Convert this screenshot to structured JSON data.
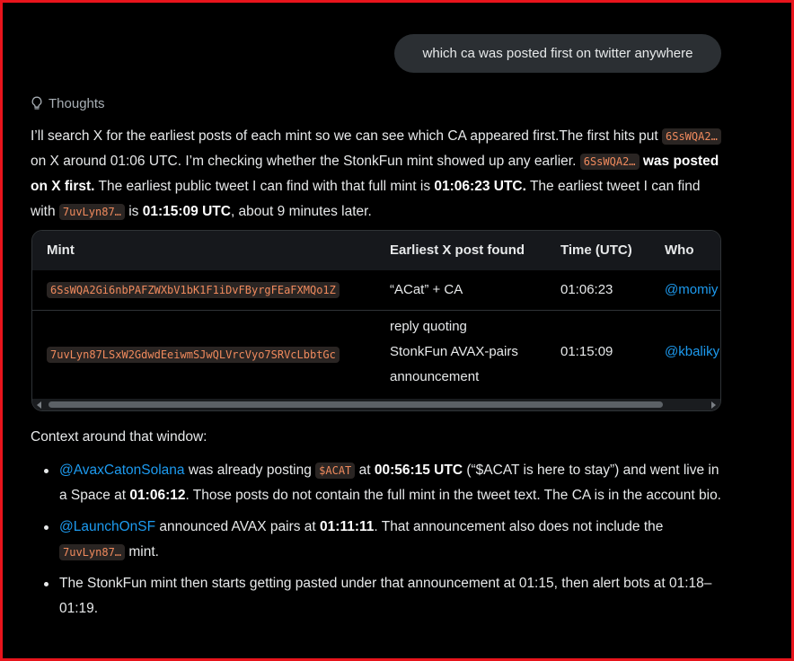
{
  "user_message": "which ca was posted first on twitter anywhere",
  "thoughts_label": "Thoughts",
  "intro": {
    "t1": "I’ll search X for the earliest posts of each mint so we can see which CA appeared first.The first hits put ",
    "c1": "6SsWQA2…",
    "t2": " on X around 01:06 UTC. I’m checking whether the StonkFun mint showed up any earlier. ",
    "c2": "6SsWQA2…",
    "b1": " was posted on X first.",
    "t3": " The earliest public tweet I can find with that full mint is ",
    "b2": "01:06:23 UTC.",
    "t4": " The earliest tweet I can find with ",
    "c3": "7uvLyn87…",
    "t5": " is ",
    "b3": "01:15:09 UTC",
    "t6": ", about 9 minutes later."
  },
  "table": {
    "headers": [
      "Mint",
      "Earliest X post found",
      "Time (UTC)",
      "Who"
    ],
    "rows": [
      {
        "mint": "6SsWQA2Gi6nbPAFZWXbV1bK1F1iDvFByrgFEaFXMQo1Z",
        "post": "“ACat” + CA",
        "time": "01:06:23",
        "who": "@momiy"
      },
      {
        "mint": "7uvLyn87LSxW2GdwdEeiwmSJwQLVrcVyo7SRVcLbbtGc",
        "post_lines": [
          "reply quoting",
          "StonkFun AVAX-pairs",
          "announcement"
        ],
        "time": "01:15:09",
        "who": "@kbaliky"
      }
    ]
  },
  "context_title": "Context around that window:",
  "bullets": {
    "b1": {
      "l1": "@AvaxCatonSolana",
      "t1": " was already posting ",
      "c1": "$ACAT",
      "t2": " at ",
      "s1": "00:56:15 UTC",
      "t3": " (“$ACAT is here to stay”) and went live in a Space at ",
      "s2": "01:06:12",
      "t4": ". Those posts do not contain the full mint in the tweet text. The CA is in the account bio."
    },
    "b2": {
      "l1": "@LaunchOnSF",
      "t1": " announced AVAX pairs at ",
      "s1": "01:11:11",
      "t2": ". That announcement also does not include the ",
      "c1": "7uvLyn87…",
      "t3": " mint."
    },
    "b3": {
      "t1": "The StonkFun mint then starts getting pasted under that announcement at 01:15, then alert bots at 01:18–01:19."
    }
  },
  "colors": {
    "accent_link": "#1d9bf0",
    "code_text": "#f08a5d",
    "frame_border": "#e8141c"
  }
}
